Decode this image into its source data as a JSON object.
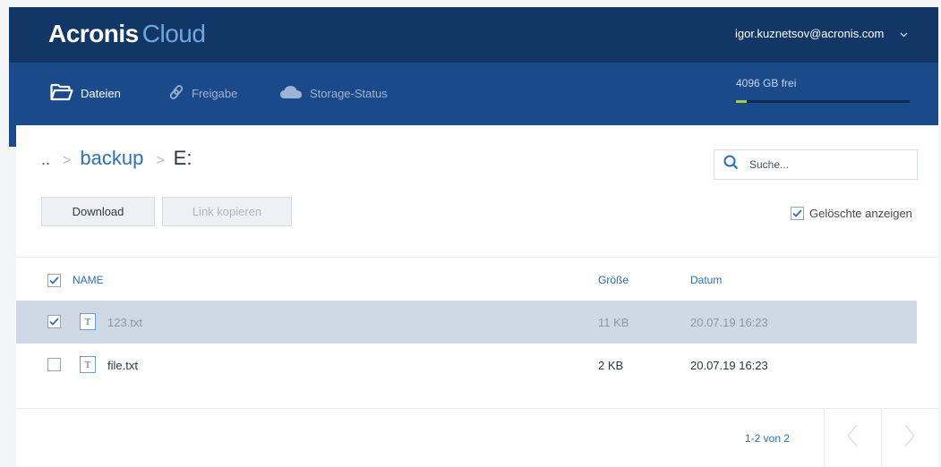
{
  "header": {
    "logo_brand": "Acronis",
    "logo_product": "Cloud",
    "user_email": "igor.kuznetsov@acronis.com"
  },
  "nav": {
    "items": [
      {
        "label": "Dateien",
        "icon": "folder-icon",
        "active": true
      },
      {
        "label": "Freigabe",
        "icon": "link-icon",
        "active": false
      },
      {
        "label": "Storage-Status",
        "icon": "cloud-icon",
        "active": false
      }
    ],
    "storage_free": "4096 GB frei",
    "storage_used_fraction": 0.06
  },
  "breadcrumb": {
    "up": "..",
    "folder": "backup",
    "current": "E:"
  },
  "search": {
    "placeholder": "Suche..."
  },
  "toolbar": {
    "download_label": "Download",
    "copy_link_label": "Link kopieren",
    "show_deleted_label": "Gelöschte anzeigen",
    "show_deleted_checked": true
  },
  "table": {
    "columns": {
      "name": "NAME",
      "size": "Größe",
      "date": "Datum"
    },
    "rows": [
      {
        "icon": "T",
        "name": "123.txt",
        "size": "11 KB",
        "date": "20.07.19 16:23",
        "selected": true
      },
      {
        "icon": "T",
        "name": "file.txt",
        "size": "2 KB",
        "date": "20.07.19 16:23",
        "selected": false
      }
    ]
  },
  "pager": {
    "text": "1-2 von 2"
  },
  "colors": {
    "topbar": "#123766",
    "navbar": "#1b4a8a",
    "accent": "#2d6fb8",
    "storage_fill": "#a6ce39",
    "selected_row": "#cfd9e6"
  }
}
